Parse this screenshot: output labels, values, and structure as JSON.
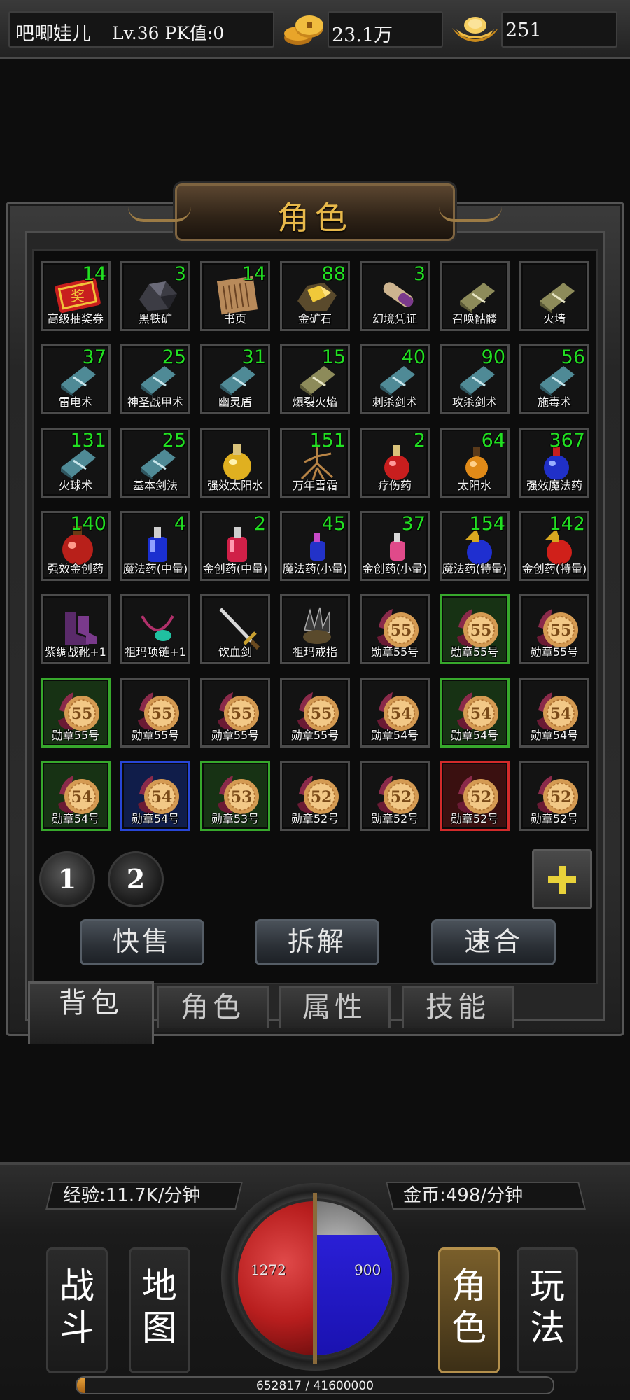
{
  "player": {
    "name": "吧唧娃儿",
    "level_text": "Lv.36 PK值:0"
  },
  "currency": {
    "gold": "23.1万",
    "ingot": "251"
  },
  "panel": {
    "title": "角色"
  },
  "inventory": [
    {
      "name": "高级抽奖券",
      "count": "14",
      "icon": "ticket",
      "quality": "normal"
    },
    {
      "name": "黑铁矿",
      "count": "3",
      "icon": "ore-black",
      "quality": "normal"
    },
    {
      "name": "书页",
      "count": "14",
      "icon": "book-page",
      "quality": "normal"
    },
    {
      "name": "金矿石",
      "count": "88",
      "icon": "ore-gold",
      "quality": "normal"
    },
    {
      "name": "幻境凭证",
      "count": "3",
      "icon": "scroll",
      "quality": "normal"
    },
    {
      "name": "召唤骷髅",
      "count": "",
      "icon": "skill-book-tan",
      "quality": "normal"
    },
    {
      "name": "火墙",
      "count": "",
      "icon": "skill-book-tan",
      "quality": "normal"
    },
    {
      "name": "雷电术",
      "count": "37",
      "icon": "skill-book-teal",
      "quality": "normal"
    },
    {
      "name": "神圣战甲术",
      "count": "25",
      "icon": "skill-book-teal",
      "quality": "normal"
    },
    {
      "name": "幽灵盾",
      "count": "31",
      "icon": "skill-book-teal",
      "quality": "normal"
    },
    {
      "name": "爆裂火焰",
      "count": "15",
      "icon": "skill-book-tan",
      "quality": "normal"
    },
    {
      "name": "刺杀剑术",
      "count": "40",
      "icon": "skill-book-teal",
      "quality": "normal"
    },
    {
      "name": "攻杀剑术",
      "count": "90",
      "icon": "skill-book-teal",
      "quality": "normal"
    },
    {
      "name": "施毒术",
      "count": "56",
      "icon": "skill-book-teal",
      "quality": "normal"
    },
    {
      "name": "火球术",
      "count": "131",
      "icon": "skill-book-teal",
      "quality": "normal"
    },
    {
      "name": "基本剑法",
      "count": "25",
      "icon": "skill-book-teal",
      "quality": "normal"
    },
    {
      "name": "强效太阳水",
      "count": "",
      "icon": "potion-yellow",
      "quality": "normal"
    },
    {
      "name": "万年雪霜",
      "count": "151",
      "icon": "root",
      "quality": "normal"
    },
    {
      "name": "疗伤药",
      "count": "2",
      "icon": "potion-red",
      "quality": "normal"
    },
    {
      "name": "太阳水",
      "count": "64",
      "icon": "potion-orange",
      "quality": "normal"
    },
    {
      "name": "强效魔法药",
      "count": "367",
      "icon": "potion-blue-red",
      "quality": "normal"
    },
    {
      "name": "强效金创药",
      "count": "140",
      "icon": "potion-red-big",
      "quality": "normal"
    },
    {
      "name": "魔法药(中量)",
      "count": "4",
      "icon": "potion-blue",
      "quality": "normal"
    },
    {
      "name": "金创药(中量)",
      "count": "2",
      "icon": "potion-pink",
      "quality": "normal"
    },
    {
      "name": "魔法药(小量)",
      "count": "45",
      "icon": "potion-blue-small",
      "quality": "normal"
    },
    {
      "name": "金创药(小量)",
      "count": "37",
      "icon": "potion-pink-small",
      "quality": "normal"
    },
    {
      "name": "魔法药(特量)",
      "count": "154",
      "icon": "potion-blue-special",
      "quality": "normal"
    },
    {
      "name": "金创药(特量)",
      "count": "142",
      "icon": "potion-red-special",
      "quality": "normal"
    },
    {
      "name": "紫绸战靴+1",
      "count": "",
      "icon": "boots",
      "quality": "normal"
    },
    {
      "name": "祖玛项链+1",
      "count": "",
      "icon": "necklace",
      "quality": "normal"
    },
    {
      "name": "饮血剑",
      "count": "",
      "icon": "sword",
      "quality": "normal"
    },
    {
      "name": "祖玛戒指",
      "count": "",
      "icon": "ring",
      "quality": "normal"
    },
    {
      "name": "勋章55号",
      "count": "",
      "icon": "medal",
      "medal": "55",
      "quality": "normal"
    },
    {
      "name": "勋章55号",
      "count": "",
      "icon": "medal",
      "medal": "55",
      "quality": "green"
    },
    {
      "name": "勋章55号",
      "count": "",
      "icon": "medal",
      "medal": "55",
      "quality": "normal"
    },
    {
      "name": "勋章55号",
      "count": "",
      "icon": "medal",
      "medal": "55",
      "quality": "green"
    },
    {
      "name": "勋章55号",
      "count": "",
      "icon": "medal",
      "medal": "55",
      "quality": "normal"
    },
    {
      "name": "勋章55号",
      "count": "",
      "icon": "medal",
      "medal": "55",
      "quality": "normal"
    },
    {
      "name": "勋章55号",
      "count": "",
      "icon": "medal",
      "medal": "55",
      "quality": "normal"
    },
    {
      "name": "勋章54号",
      "count": "",
      "icon": "medal",
      "medal": "54",
      "quality": "normal"
    },
    {
      "name": "勋章54号",
      "count": "",
      "icon": "medal",
      "medal": "54",
      "quality": "green"
    },
    {
      "name": "勋章54号",
      "count": "",
      "icon": "medal",
      "medal": "54",
      "quality": "normal"
    },
    {
      "name": "勋章54号",
      "count": "",
      "icon": "medal",
      "medal": "54",
      "quality": "green"
    },
    {
      "name": "勋章54号",
      "count": "",
      "icon": "medal",
      "medal": "54",
      "quality": "blue"
    },
    {
      "name": "勋章53号",
      "count": "",
      "icon": "medal",
      "medal": "53",
      "quality": "green"
    },
    {
      "name": "勋章52号",
      "count": "",
      "icon": "medal",
      "medal": "52",
      "quality": "normal"
    },
    {
      "name": "勋章52号",
      "count": "",
      "icon": "medal",
      "medal": "52",
      "quality": "normal"
    },
    {
      "name": "勋章52号",
      "count": "",
      "icon": "medal",
      "medal": "52",
      "quality": "red"
    },
    {
      "name": "勋章52号",
      "count": "",
      "icon": "medal",
      "medal": "52",
      "quality": "normal"
    }
  ],
  "pages": [
    "1",
    "2"
  ],
  "actions": {
    "quick_sell": "快售",
    "dismantle": "拆解",
    "fuse": "速合"
  },
  "tabs": [
    "背包",
    "角色",
    "属性",
    "技能"
  ],
  "hud": {
    "exp_rate": "经验:11.7K/分钟",
    "gold_rate": "金币:498/分钟",
    "hp": "1272",
    "mp": "900",
    "mp_fill": 0.78,
    "xp_text": "652817 / 41600000",
    "xp_fraction": 0.0157,
    "nav_left": [
      "战斗",
      "地图"
    ],
    "nav_right": [
      "角色",
      "玩法"
    ]
  },
  "colors": {
    "count": "#22e022",
    "title": "#e7b84a",
    "quality_green": "#37a82c",
    "quality_blue": "#2846d6",
    "quality_red": "#d22b2b"
  }
}
